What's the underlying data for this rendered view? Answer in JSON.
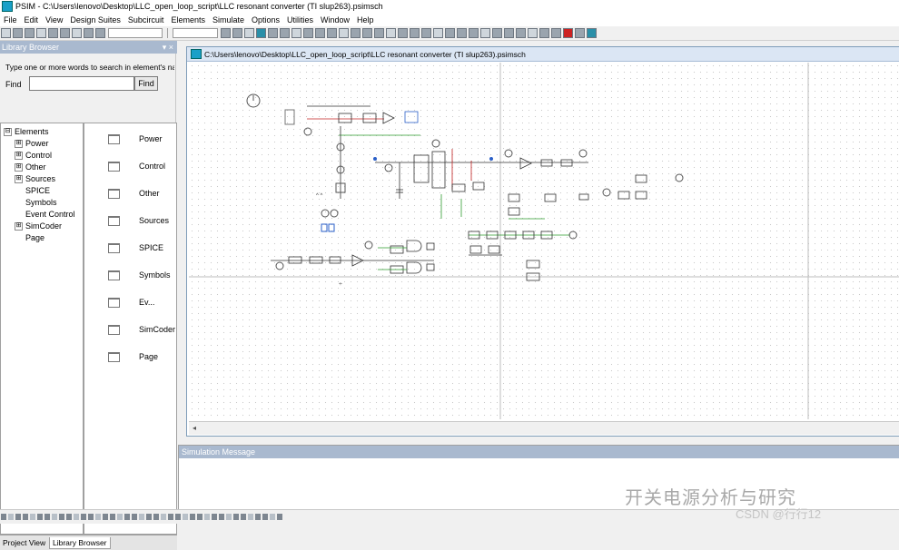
{
  "window": {
    "title": "PSIM - C:\\Users\\lenovo\\Desktop\\LLC_open_loop_script\\LLC resonant converter (TI slup263).psimsch"
  },
  "menu": [
    "File",
    "Edit",
    "View",
    "Design Suites",
    "Subcircuit",
    "Elements",
    "Simulate",
    "Options",
    "Utilities",
    "Window",
    "Help"
  ],
  "library": {
    "header": "Library Browser",
    "header_controls": "▾ ×",
    "search_hint": "Type one or more words to search in element's nam",
    "find_label": "Find",
    "find_button": "Find",
    "tree": [
      {
        "label": "Elements",
        "expander": "⊟"
      },
      {
        "label": "Power",
        "expander": "⊞"
      },
      {
        "label": "Control",
        "expander": "⊞"
      },
      {
        "label": "Other",
        "expander": "⊞"
      },
      {
        "label": "Sources",
        "expander": "⊞"
      },
      {
        "label": "SPICE",
        "expander": ""
      },
      {
        "label": "Symbols",
        "expander": ""
      },
      {
        "label": "Event Control",
        "expander": ""
      },
      {
        "label": "SimCoder",
        "expander": "⊞"
      },
      {
        "label": "Page",
        "expander": ""
      }
    ],
    "folders": [
      "Power",
      "Control",
      "Other",
      "Sources",
      "SPICE",
      "Symbols",
      "Ev...",
      "SimCoder",
      "Page"
    ],
    "tabs": [
      "Project View",
      "Library Browser"
    ]
  },
  "schematic": {
    "title": "C:\\Users\\lenovo\\Desktop\\LLC_open_loop_script\\LLC resonant converter (TI slup263).psimsch"
  },
  "sim_message": {
    "header": "Simulation Message"
  },
  "watermark": {
    "main": "开关电源分析与研究",
    "sub": "CSDN @行行12"
  },
  "colors": {
    "accent": "#a9b9cf",
    "wire_green": "#2e9b2e",
    "wire_red": "#c02020",
    "wire_blue": "#2a5fc8"
  }
}
